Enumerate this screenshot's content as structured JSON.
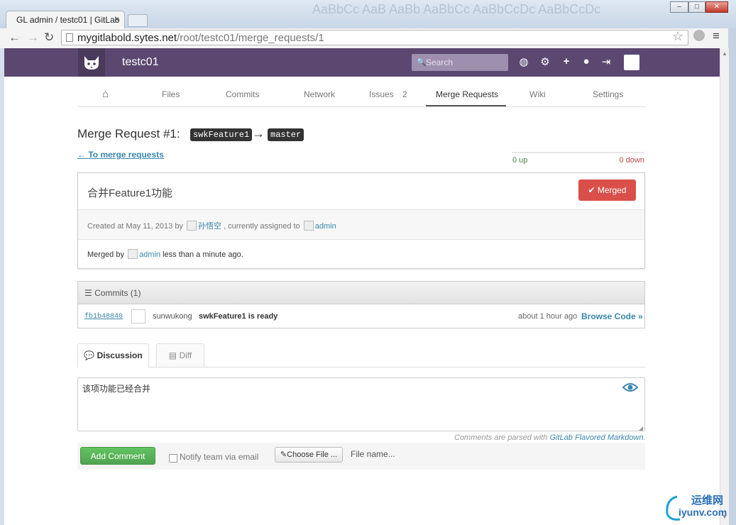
{
  "browser": {
    "tab_title": "GL admin / testc01 | GitLab",
    "tab_close": "×",
    "url_host": "mygitlabold.sytes.net",
    "url_path": "/root/testc01/merge_requests/1",
    "ribbon_text": "AaBbCc AaB AaBb AaBbCc AaBbCcDc AaBbCcDc"
  },
  "header": {
    "project_name": "testc01",
    "search_placeholder": "Search"
  },
  "project_nav": {
    "items": [
      {
        "label": "Files"
      },
      {
        "label": "Commits"
      },
      {
        "label": "Network"
      },
      {
        "label": "Issues",
        "count": "2"
      },
      {
        "label": "Merge Requests"
      },
      {
        "label": "Wiki"
      },
      {
        "label": "Settings"
      }
    ]
  },
  "merge_request": {
    "title_prefix": "Merge Request #1:",
    "source_branch": "swkFeature1",
    "arrow": "→",
    "target_branch": "master",
    "back_link": "← To merge requests",
    "votes_up": "0 up",
    "votes_down": "0 down",
    "name": "合并Feature1功能",
    "status_button": "✔ Merged",
    "created_text": "Created at May 11, 2013 by",
    "author": "孙悟空",
    "assigned_text": ", currently assigned to",
    "assignee": "admin",
    "merged_by_label": "Merged by",
    "merged_by_user": "admin",
    "merged_time": "less than a minute ago."
  },
  "commits": {
    "header": "Commits (1)",
    "rows": [
      {
        "sha": "fb1b48840",
        "author": "sunwukong",
        "message": "swkFeature1 is ready",
        "time": "about 1 hour ago",
        "browse": "Browse Code »"
      }
    ]
  },
  "tabs": {
    "discussion": "Discussion",
    "diff": "Diff"
  },
  "comment": {
    "value": "该项功能已经合并",
    "markdown_note_prefix": "Comments are parsed with",
    "markdown_note_link": "GitLab Flavored Markdown",
    "markdown_note_suffix": ".",
    "add_button": "Add Comment",
    "notify_label": "Notify team via email",
    "choose_file": "✎Choose File ...",
    "file_name": "File name..."
  },
  "watermark": {
    "line1": "运维网",
    "line2": "iyunv.com"
  },
  "colors": {
    "header_bg": "#5b4770",
    "merged_red": "#da4f49",
    "add_green": "#51a351",
    "link_blue": "#3a87ad"
  }
}
